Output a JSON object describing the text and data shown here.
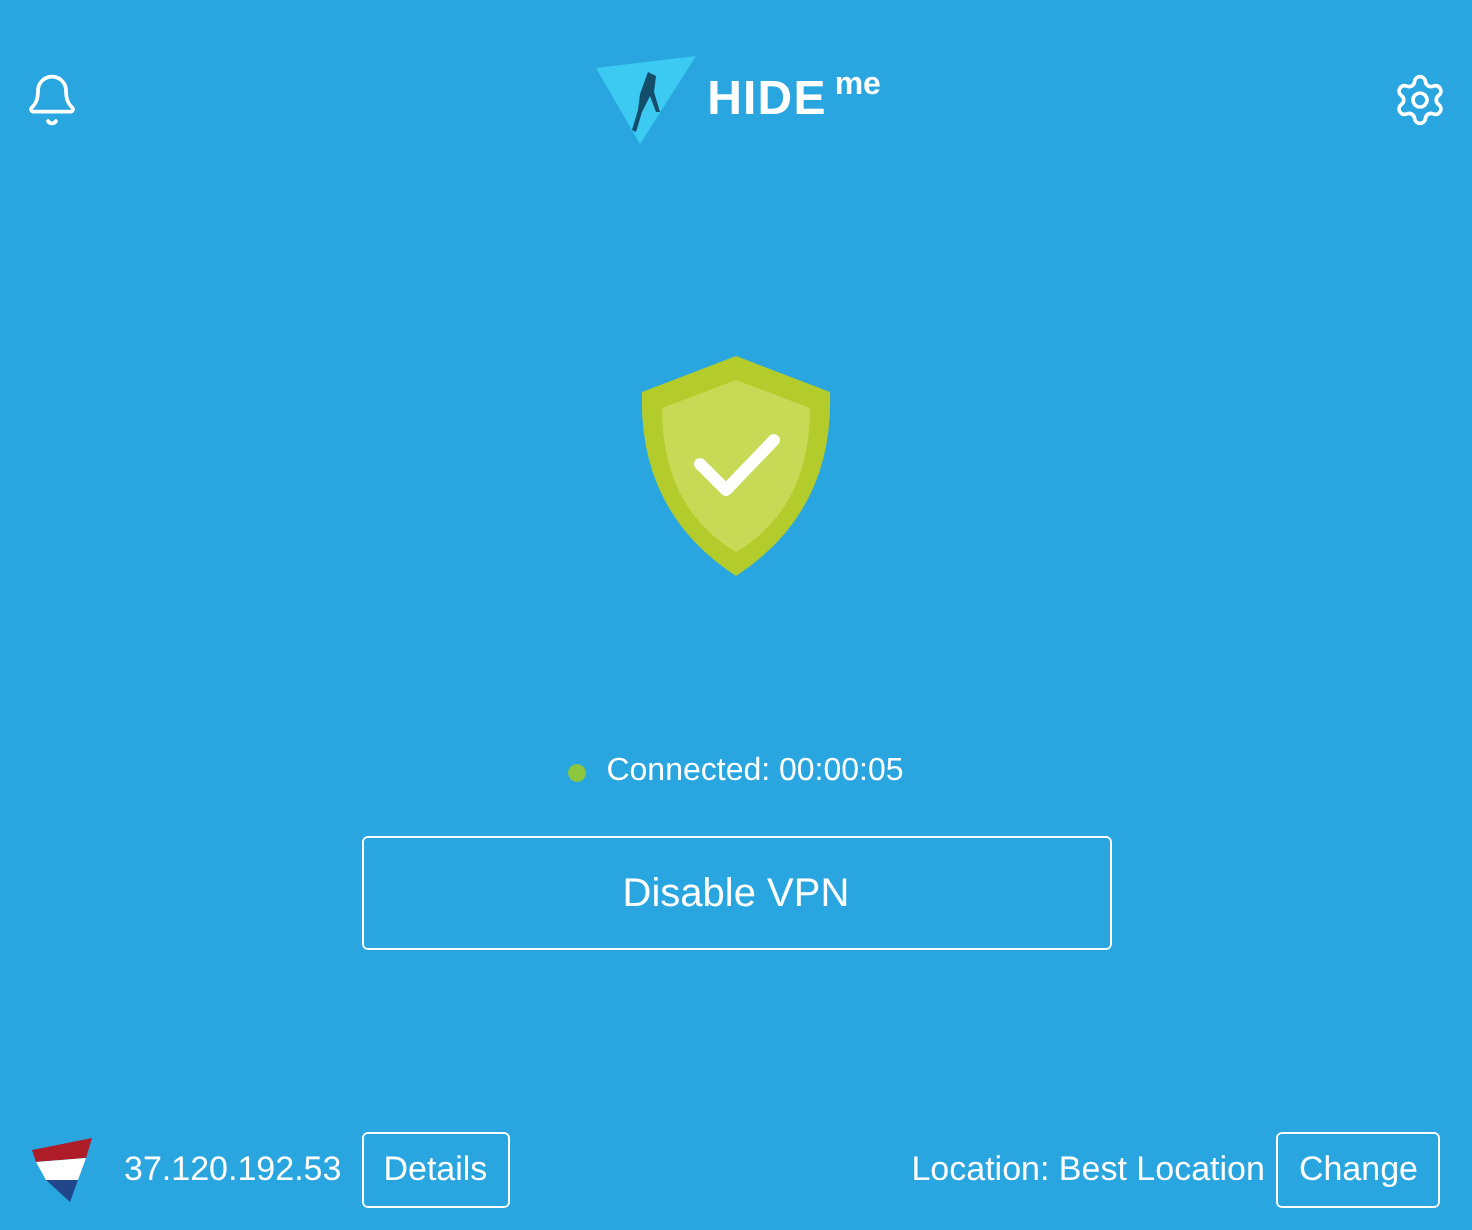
{
  "header": {
    "logo_text": "HIDE",
    "logo_suffix": "me"
  },
  "status": {
    "connected": true,
    "color": "#8cc63e",
    "text": "Connected: 00:00:05"
  },
  "main_button": "Disable VPN",
  "footer": {
    "ip": "37.120.192.53",
    "details_button": "Details",
    "location": "Location: Best Location",
    "change_button": "Change"
  }
}
